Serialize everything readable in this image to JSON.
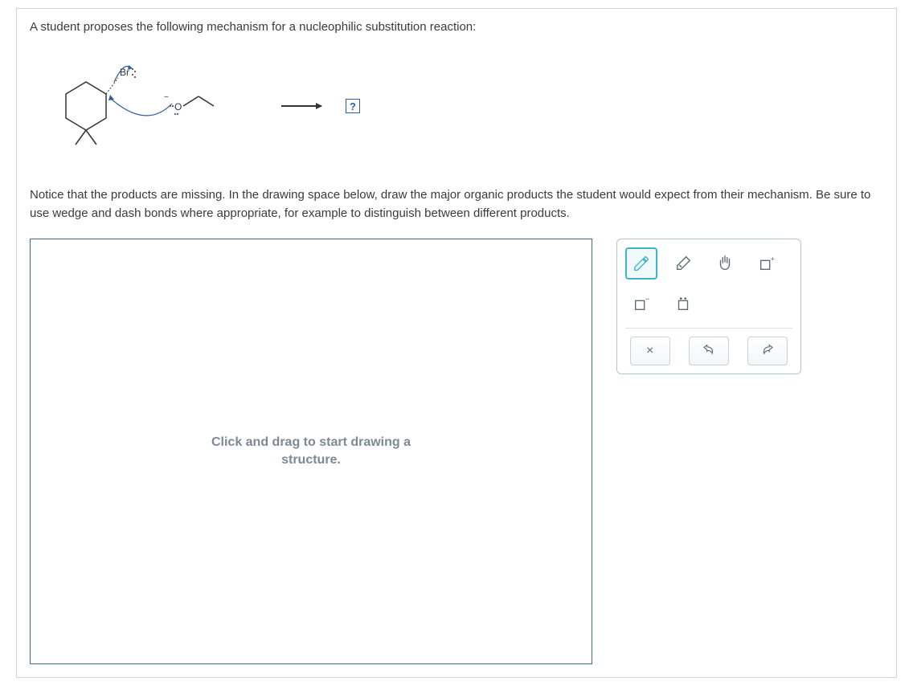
{
  "problem_intro": "A student proposes the following mechanism for a nucleophilic substitution reaction:",
  "mechanism": {
    "br_label": "Br",
    "o_label": "O",
    "question_mark": "?"
  },
  "instruction": "Notice that the products are missing. In the drawing space below, draw the major organic products the student would expect from their mechanism. Be sure to use wedge and dash bonds where appropriate, for example to distinguish between different products.",
  "canvas_placeholder_line1": "Click and drag to start drawing a",
  "canvas_placeholder_line2": "structure.",
  "tools": {
    "pencil": "pencil",
    "eraser": "eraser",
    "hand": "hand",
    "charge_plus": "positive-charge",
    "charge_minus": "negative-charge",
    "lone_pair": "lone-pair",
    "clear": "×",
    "undo": "undo",
    "redo": "redo"
  }
}
